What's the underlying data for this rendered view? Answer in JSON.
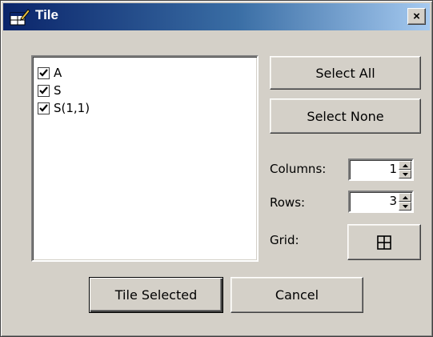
{
  "window": {
    "title": "Tile",
    "close_glyph": "×"
  },
  "icons": {
    "title": "tile-window-icon",
    "grid": "grid-2x2-icon",
    "check": "checkmark-icon"
  },
  "list": {
    "items": [
      {
        "label": "A",
        "checked": true
      },
      {
        "label": "S",
        "checked": true
      },
      {
        "label": "S(1,1)",
        "checked": true
      }
    ]
  },
  "buttons": {
    "select_all": "Select All",
    "select_none": "Select None",
    "tile_selected": "Tile Selected",
    "cancel": "Cancel"
  },
  "fields": {
    "columns_label": "Columns:",
    "columns_value": "1",
    "rows_label": "Rows:",
    "rows_value": "3",
    "grid_label": "Grid:"
  },
  "colors": {
    "titlebar_start": "#0a246a",
    "titlebar_end": "#a6caf0",
    "face": "#d4d0c8"
  }
}
